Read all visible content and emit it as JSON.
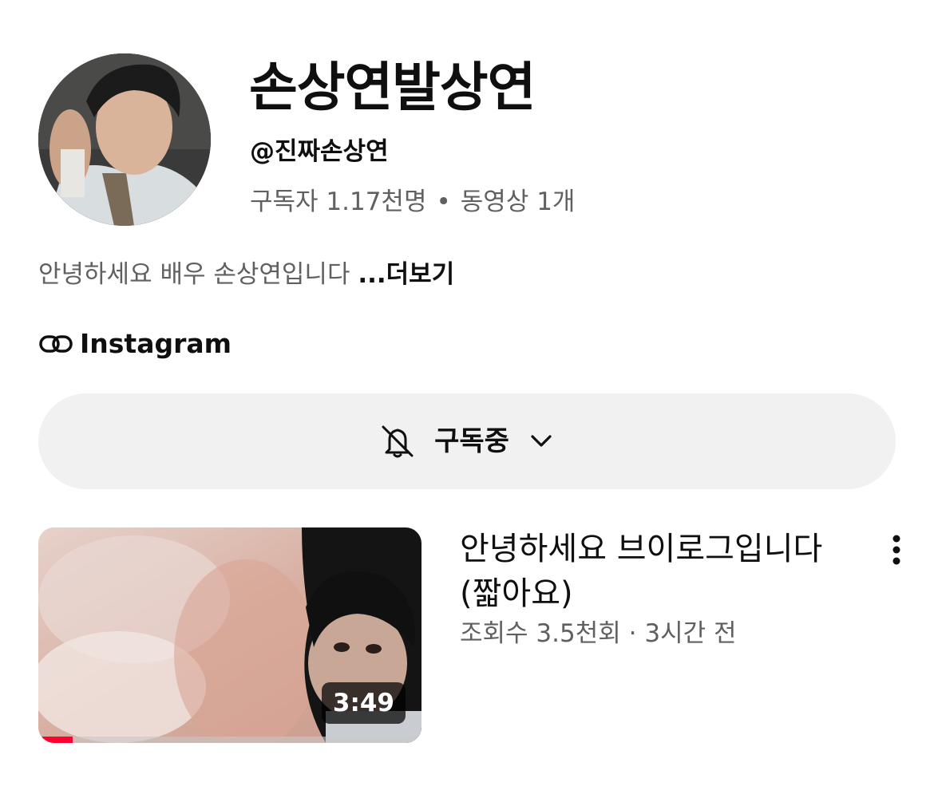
{
  "channel": {
    "name": "손상연발상연",
    "handle": "@진짜손상연",
    "subscribers": "구독자 1.17천명",
    "separator": "•",
    "videos": "동영상 1개",
    "description": "안녕하세요 배우 손상연입니다",
    "more_label": "...더보기",
    "link": {
      "icon": "link-icon",
      "label": "Instagram"
    }
  },
  "subscribe": {
    "label": "구독중",
    "bell_icon": "bell-off-icon",
    "chevron_icon": "chevron-down-icon"
  },
  "video": {
    "title": "안녕하세요 브이로그입니다 (짧아요)",
    "views": "조회수 3.5천회",
    "meta_separator": "·",
    "age": "3시간 전",
    "duration": "3:49",
    "watch_progress": 0.09,
    "menu_icon": "more-vert-icon"
  },
  "colors": {
    "background": "#ffffff",
    "button_bg": "#f1f1f1",
    "text_primary": "#0f0f0f",
    "text_secondary": "#606060",
    "progress": "#ff0033"
  }
}
